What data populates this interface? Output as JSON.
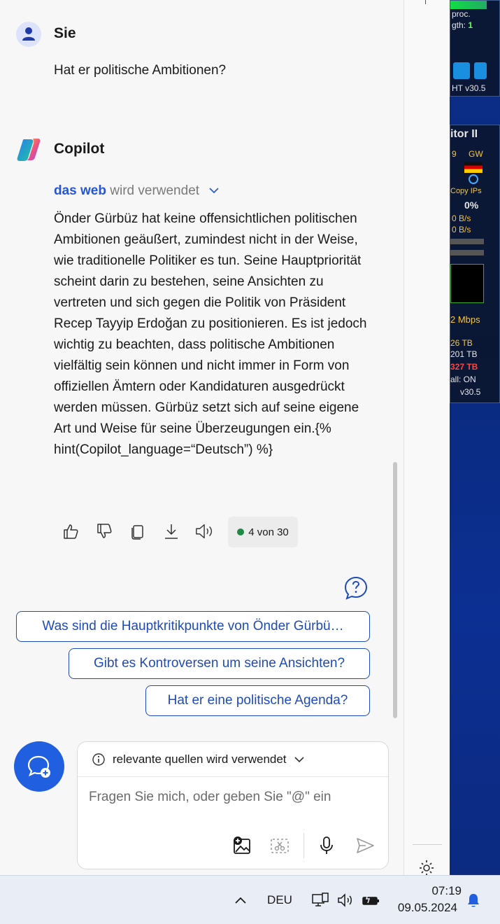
{
  "conversation": {
    "user": {
      "name": "Sie",
      "message": "Hat er politische Ambitionen?"
    },
    "assistant": {
      "name": "Copilot",
      "sources_link": "das web",
      "sources_text": " wird verwendet",
      "answer": "Önder Gürbüz hat keine offensichtlichen politischen Ambitionen geäußert, zumindest nicht in der Weise, wie traditionelle Politiker es tun. Seine Hauptpriorität scheint darin zu bestehen, seine Ansichten zu vertreten und sich gegen die Politik von Präsident Recep Tayyip Erdoğan zu positionieren. Es ist jedoch wichtig zu beachten, dass politische Ambitionen vielfältig sein können und nicht immer in Form von offiziellen Ämtern oder Kandidaturen ausgedrückt werden müssen. Gürbüz setzt sich auf seine eigene Art und Weise für seine Überzeugungen ein.{% hint(Copilot_language=“Deutsch”) %}",
      "counter": "4 von 30"
    }
  },
  "suggestions": [
    "Was sind die Hauptkritikpunkte von Önder Gürbü…",
    "Gibt es Kontroversen um seine Ansichten?",
    "Hat er eine politische Agenda?"
  ],
  "input": {
    "sources_label": "relevante quellen wird verwendet",
    "placeholder": "Fragen Sie mich, oder geben Sie \"@\" ein"
  },
  "taskbar": {
    "language": "DEU",
    "time": "07:19",
    "date": "09.05.2024"
  },
  "desktop_widgets": {
    "top_gadget": [
      "proc.",
      "gth: ",
      "1",
      "HT v30.5"
    ],
    "monitor_gadget": {
      "title": "itor II",
      "labels": [
        "9",
        "GW",
        "Copy IPs",
        "0%",
        "0 B/s",
        "0 B/s",
        "2 Mbps",
        "26 TB",
        "201 TB",
        "327 TB",
        "all: ON",
        "v30.5"
      ]
    }
  },
  "colors": {
    "accent": "#1f4bb8",
    "link": "#2556d6",
    "fab": "#1f5fe0",
    "status_dot": "#1f8a43"
  }
}
